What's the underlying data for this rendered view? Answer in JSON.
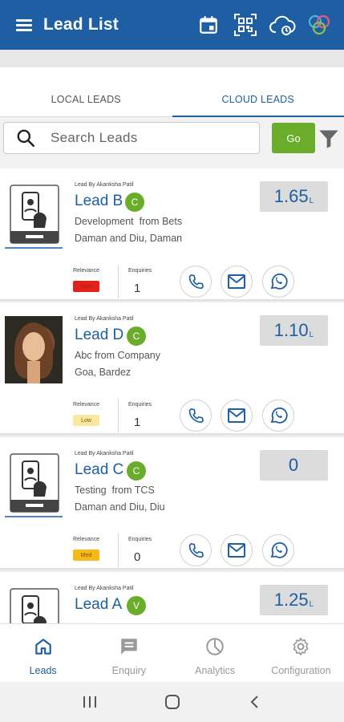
{
  "app": {
    "title": "Lead List"
  },
  "tabs": [
    {
      "label": "LOCAL LEADS",
      "active": false
    },
    {
      "label": "CLOUD LEADS",
      "active": true
    }
  ],
  "search": {
    "placeholder": "Search Leads",
    "go_label": "Go"
  },
  "leads": [
    {
      "lead_by": "Lead By Akanksha Patil",
      "name": "Lead B",
      "status": "C",
      "description": "Development  from Bets",
      "location": "Daman and Diu, Daman",
      "amount": "1.65",
      "amount_unit": "L",
      "relevance_label": "Relevance",
      "relevance": "High",
      "relevance_color": "#e3231b",
      "enquiries_label": "Enquiries",
      "enquiries": "1",
      "thumb": "phone-thumb"
    },
    {
      "lead_by": "Lead By Akanksha Patil",
      "name": "Lead D",
      "status": "C",
      "description": "Abc from Company",
      "location": "Goa, Bardez",
      "amount": "1.10",
      "amount_unit": "L",
      "relevance_label": "Relevance",
      "relevance": "Low",
      "relevance_color": "#fde6a0",
      "enquiries_label": "Enquiries",
      "enquiries": "1",
      "thumb": "photo"
    },
    {
      "lead_by": "Lead By Akanksha Patil",
      "name": "Lead C",
      "status": "C",
      "description": "Testing  from TCS",
      "location": "Daman and Diu, Diu",
      "amount": "0",
      "amount_unit": "",
      "relevance_label": "Relevance",
      "relevance": "Med",
      "relevance_color": "#f6b81a",
      "enquiries_label": "Enquiries",
      "enquiries": "0",
      "thumb": "phone-thumb"
    },
    {
      "lead_by": "Lead By Akanksha Patil",
      "name": "Lead A",
      "status": "V",
      "description": "",
      "location": "",
      "amount": "1.25",
      "amount_unit": "L",
      "relevance_label": "",
      "relevance": "",
      "relevance_color": "#ffffff",
      "enquiries_label": "",
      "enquiries": "",
      "thumb": "phone-thumb"
    }
  ],
  "bottom_nav": [
    {
      "label": "Leads",
      "icon": "home-icon",
      "active": true
    },
    {
      "label": "Enquiry",
      "icon": "chat-icon",
      "active": false
    },
    {
      "label": "Analytics",
      "icon": "pie-chart-icon",
      "active": false
    },
    {
      "label": "Configuration",
      "icon": "gear-icon",
      "active": false
    }
  ],
  "colors": {
    "primary": "#1d5fa2",
    "accent_green": "#6aad2b",
    "amount_bg": "#dcdcdc"
  }
}
